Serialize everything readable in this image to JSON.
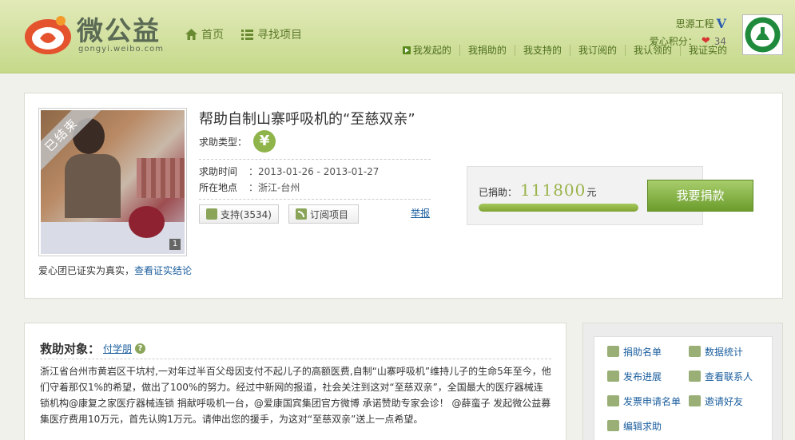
{
  "header": {
    "logo_text": "微公益",
    "logo_sub": "gongyi.weibo.com",
    "nav": [
      {
        "label": "首页",
        "icon": "home-icon"
      },
      {
        "label": "寻找项目",
        "icon": "list-icon"
      }
    ],
    "user": {
      "name": "思源工程",
      "verify_mark": "V",
      "points_label": "爱心积分：",
      "points": "34"
    },
    "subnav": [
      "我发起的",
      "我捐助的",
      "我支持的",
      "我订阅的",
      "我认领的",
      "我证实的"
    ]
  },
  "project": {
    "ended_label": "已结束",
    "photo_count": "1",
    "verified_text": "爱心团已证实为真实，",
    "verified_link": "查看证实结论",
    "title": "帮助自制山寨呼吸机的“至慈双亲”",
    "help_type_label": "求助类型：",
    "time_label": "求助时间",
    "time_value": "：2013-01-26 - 2013-01-27",
    "location_label": "所在地点",
    "location_value": "：浙江-台州",
    "support_label": "支持(3534)",
    "subscribe_label": "订阅项目",
    "report_label": "举报"
  },
  "donation": {
    "label": "已捐助：",
    "amount": "111800",
    "unit": "元",
    "progress": 1.0,
    "button": "我要捐款"
  },
  "description": {
    "title": "救助对象：",
    "person": "付学朋",
    "help_mark": "?",
    "text": "浙江省台州市黄岩区干坑村,一对年过半百父母因支付不起儿子的高额医费,自制“山寨呼吸机”维持儿子的生命5年至今，他们守着那仅1%的希望，做出了100%的努力。经过中新网的报道，社会关注到这对“至慈双亲”，全国最大的医疗器械连锁机构@康复之家医疗器械连锁 捐献呼吸机一台，@爱康国宾集团官方微博 承诺赞助专家会诊！ @薛蛮子 发起微公益募集医疗费用10万元，首先认购1万元。请伸出您的援手，为这对“至慈双亲”送上一点希望。"
  },
  "sidebar": {
    "items": [
      {
        "label": "捐助名单",
        "icon": "donor-list-icon"
      },
      {
        "label": "数据统计",
        "icon": "stats-icon"
      },
      {
        "label": "发布进展",
        "icon": "publish-progress-icon"
      },
      {
        "label": "查看联系人",
        "icon": "view-contact-icon"
      },
      {
        "label": "发票申请名单",
        "icon": "invoice-icon"
      },
      {
        "label": "邀请好友",
        "icon": "invite-friend-icon"
      },
      {
        "label": "编辑求助",
        "icon": "edit-icon"
      }
    ]
  }
}
